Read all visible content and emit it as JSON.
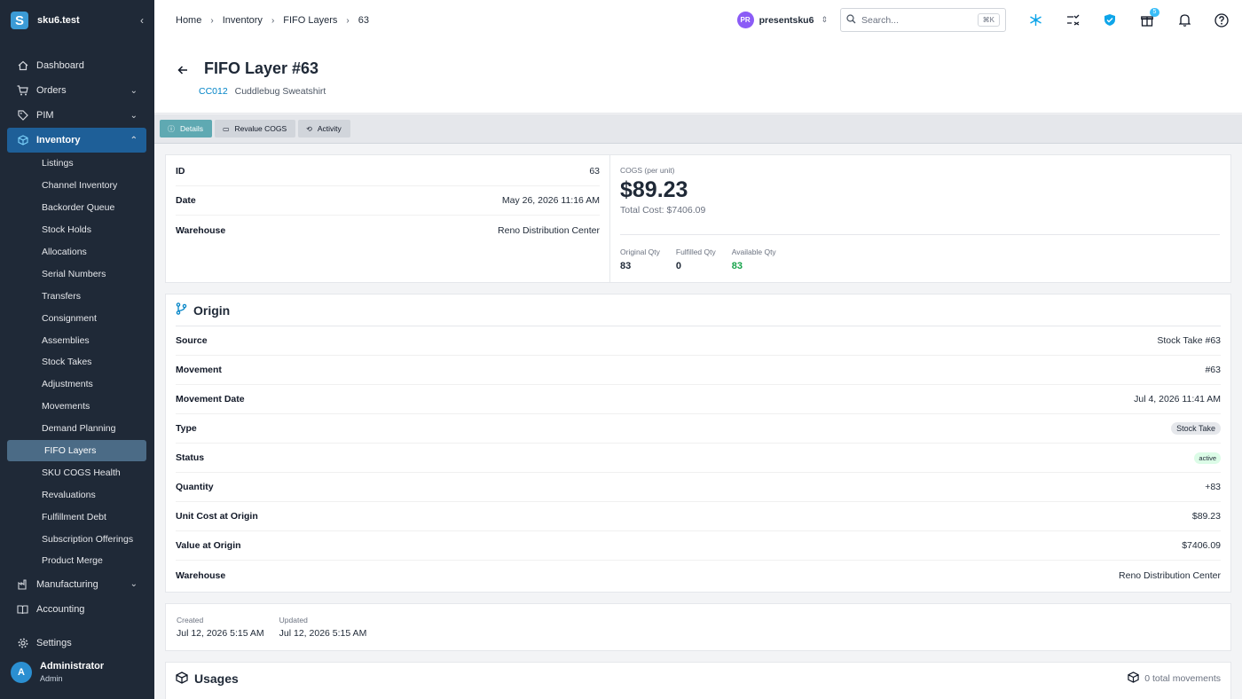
{
  "sidebar": {
    "brand": "sku6.test",
    "logo_letter": "S",
    "items": [
      {
        "label": "Dashboard",
        "icon": "home-icon"
      },
      {
        "label": "Orders",
        "icon": "cart-icon"
      },
      {
        "label": "PIM",
        "icon": "tag-icon"
      },
      {
        "label": "Inventory",
        "icon": "cube-icon"
      }
    ],
    "inventory_sub": [
      "Listings",
      "Channel Inventory",
      "Backorder Queue",
      "Stock Holds",
      "Allocations",
      "Serial Numbers",
      "Transfers",
      "Consignment",
      "Assemblies",
      "Stock Takes",
      "Adjustments",
      "Movements",
      "Demand Planning",
      "FIFO Layers",
      "SKU COGS Health",
      "Revaluations",
      "Fulfillment Debt",
      "Subscription Offerings",
      "Product Merge"
    ],
    "after_items": [
      {
        "label": "Manufacturing",
        "icon": "factory-icon"
      },
      {
        "label": "Accounting",
        "icon": "book-icon"
      }
    ],
    "settings": "Settings",
    "user": {
      "initial": "A",
      "name": "Administrator",
      "role": "Admin"
    }
  },
  "topbar": {
    "breadcrumbs": [
      "Home",
      "Inventory",
      "FIFO Layers",
      "63"
    ],
    "org_initials": "PR",
    "org_name": "presentsku6",
    "search_placeholder": "Search...",
    "search_shortcut": "⌘K",
    "gift_badge": "5"
  },
  "header": {
    "title": "FIFO Layer #63",
    "sku": "CC012",
    "product": "Cuddlebug Sweatshirt"
  },
  "tabs": [
    {
      "label": "Details"
    },
    {
      "label": "Revalue COGS"
    },
    {
      "label": "Activity"
    }
  ],
  "summary": {
    "rows": [
      {
        "label": "ID",
        "value": "63"
      },
      {
        "label": "Date",
        "value": "May 26, 2026 11:16 AM"
      },
      {
        "label": "Warehouse",
        "value": "Reno Distribution Center"
      }
    ],
    "cogs_label": "COGS (per unit)",
    "cogs_value": "$89.23",
    "total_cost": "Total Cost: $7406.09",
    "qty": [
      {
        "label": "Original Qty",
        "value": "83"
      },
      {
        "label": "Fulfilled Qty",
        "value": "0"
      },
      {
        "label": "Available Qty",
        "value": "83"
      }
    ]
  },
  "origin": {
    "title": "Origin",
    "rows": [
      {
        "label": "Source",
        "value": "Stock Take #63"
      },
      {
        "label": "Movement",
        "value": "#63"
      },
      {
        "label": "Movement Date",
        "value": "Jul 4, 2026 11:41 AM"
      },
      {
        "label": "Type",
        "value": "Stock Take"
      },
      {
        "label": "Status",
        "value": "active"
      },
      {
        "label": "Quantity",
        "value": "+83"
      },
      {
        "label": "Unit Cost at Origin",
        "value": "$89.23"
      },
      {
        "label": "Value at Origin",
        "value": "$7406.09"
      },
      {
        "label": "Warehouse",
        "value": "Reno Distribution Center"
      }
    ]
  },
  "dates": {
    "created_label": "Created",
    "created": "Jul 12, 2026 5:15 AM",
    "updated_label": "Updated",
    "updated": "Jul 12, 2026 5:15 AM"
  },
  "usages": {
    "title": "Usages",
    "count": "0 total movements"
  }
}
